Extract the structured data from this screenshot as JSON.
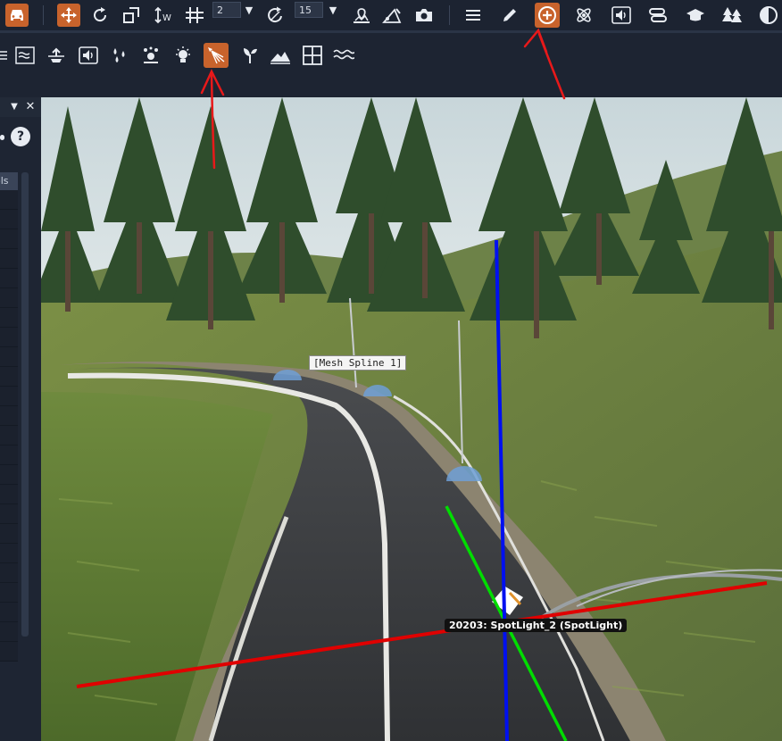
{
  "toolbar_top": {
    "items": [
      {
        "name": "vehicle-icon"
      },
      {
        "name": "move-tool-icon"
      },
      {
        "name": "rotate-tool-icon"
      },
      {
        "name": "scale-tool-icon"
      },
      {
        "name": "height-snap-icon"
      },
      {
        "name": "grid-snap-icon"
      },
      {
        "name": "rotate-snap-icon"
      },
      {
        "name": "terrain-snap-icon"
      },
      {
        "name": "angle-snap-icon"
      },
      {
        "name": "camera-icon"
      },
      {
        "name": "menu-icon"
      },
      {
        "name": "pencil-icon"
      },
      {
        "name": "add-object-icon"
      },
      {
        "name": "atom-icon"
      },
      {
        "name": "sound-icon"
      },
      {
        "name": "route-icon"
      },
      {
        "name": "graduation-cap-icon"
      },
      {
        "name": "forest-icon"
      },
      {
        "name": "timeofday-icon"
      }
    ],
    "grid_snap_value": "2",
    "rotate_snap_value": "15"
  },
  "toolbar_second": {
    "items": [
      {
        "name": "river-icon"
      },
      {
        "name": "water-plane-icon"
      },
      {
        "name": "sound-emitter-icon"
      },
      {
        "name": "precipitation-icon"
      },
      {
        "name": "particle-emitter-icon"
      },
      {
        "name": "point-light-icon"
      },
      {
        "name": "spot-light-icon"
      },
      {
        "name": "ground-cover-icon"
      },
      {
        "name": "terrain-block-icon"
      },
      {
        "name": "grid-plane-icon"
      },
      {
        "name": "waves-icon"
      }
    ]
  },
  "side_panel": {
    "help_symbol": "?",
    "close_symbol": "✕",
    "dropdown_symbol": "▼",
    "tab_label": "ols"
  },
  "viewport": {
    "mesh_label": "[Mesh Spline 1]",
    "spot_label": "20203: SpotLight_2 (SpotLight)"
  },
  "colors": {
    "toolbar_bg": "#1c2331",
    "active_orange": "#c8632c",
    "annotation_red": "#e8191a",
    "gizmo_x": "#e00000",
    "gizmo_y": "#00dd00",
    "gizmo_z": "#0010f0"
  }
}
